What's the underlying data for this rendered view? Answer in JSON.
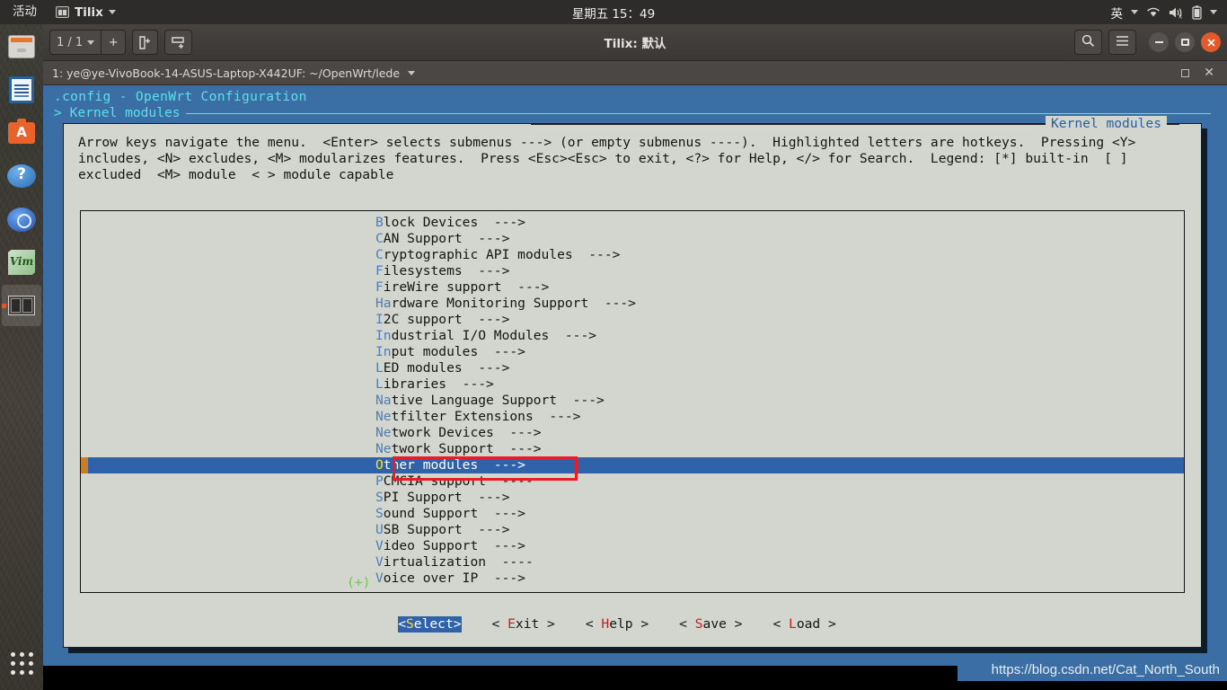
{
  "topbar": {
    "activities": "活动",
    "app_name": "Tilix",
    "app_icon": "terminal-icon",
    "clock_weekday": "星期五",
    "clock_time": "15：49",
    "ime": "英",
    "icons": [
      "wifi-icon",
      "volume-muted-icon",
      "battery-icon",
      "chevron-down-icon"
    ]
  },
  "dock": {
    "items": [
      {
        "name": "files",
        "icon": "files-icon"
      },
      {
        "name": "libreoffice-writer",
        "icon": "document-icon"
      },
      {
        "name": "ubuntu-software",
        "icon": "briefcase-icon"
      },
      {
        "name": "help",
        "icon": "question-mark-icon"
      },
      {
        "name": "chromium",
        "icon": "chromium-icon"
      },
      {
        "name": "vim",
        "icon": "vim-icon"
      },
      {
        "name": "tilix",
        "icon": "tilix-icon",
        "active": true
      }
    ],
    "show_apps": "show-applications-grid"
  },
  "window": {
    "title": "Tilix: 默认",
    "session_counter": "1 / 1",
    "buttons": {
      "new_session": "+",
      "new_terminal_right": "split-right-icon",
      "new_terminal_down": "split-down-icon",
      "search": "search-icon",
      "menu": "hamburger-menu-icon",
      "minimize": "minimize-icon",
      "maximize": "maximize-icon",
      "close": "close-icon"
    },
    "tab_title": "1: ye@ye-VivoBook-14-ASUS-Laptop-X442UF: ~/OpenWrt/lede"
  },
  "menuconfig": {
    "config_title": ".config - OpenWrt Configuration",
    "breadcrumb": "> Kernel modules",
    "dialog_title": "Kernel modules",
    "help_text": "Arrow keys navigate the menu.  <Enter> selects submenus ---> (or empty submenus ----).  Highlighted letters are hotkeys.  Pressing <Y>\nincludes, <N> excludes, <M> modularizes features.  Press <Esc><Esc> to exit, <?> for Help, </> for Search.  Legend: [*] built-in  [ ]\nexcluded  <M> module  < > module capable",
    "scroll_indicator": "(+)",
    "items": [
      {
        "hotkey": "B",
        "rest": "lock Devices",
        "arrow": "--->",
        "selected": false
      },
      {
        "hotkey": "C",
        "rest": "AN Support",
        "arrow": "--->",
        "selected": false
      },
      {
        "hotkey": "C",
        "rest": "ryptographic API modules",
        "arrow": "--->",
        "selected": false
      },
      {
        "hotkey": "F",
        "rest": "ilesystems",
        "arrow": "--->",
        "selected": false
      },
      {
        "hotkey": "F",
        "rest": "ireWire support",
        "arrow": "--->",
        "selected": false
      },
      {
        "hotkey": "Ha",
        "rest": "rdware Monitoring Support",
        "arrow": "--->",
        "selected": false
      },
      {
        "hotkey": "I",
        "rest": "2C support",
        "arrow": "--->",
        "selected": false
      },
      {
        "hotkey": "In",
        "rest": "dustrial I/O Modules",
        "arrow": "--->",
        "selected": false
      },
      {
        "hotkey": "In",
        "rest": "put modules",
        "arrow": "--->",
        "selected": false
      },
      {
        "hotkey": "L",
        "rest": "ED modules",
        "arrow": "--->",
        "selected": false
      },
      {
        "hotkey": "L",
        "rest": "ibraries",
        "arrow": "--->",
        "selected": false
      },
      {
        "hotkey": "Na",
        "rest": "tive Language Support",
        "arrow": "--->",
        "selected": false
      },
      {
        "hotkey": "Ne",
        "rest": "tfilter Extensions",
        "arrow": "--->",
        "selected": false
      },
      {
        "hotkey": "Ne",
        "rest": "twork Devices",
        "arrow": "--->",
        "selected": false
      },
      {
        "hotkey": "Ne",
        "rest": "twork Support",
        "arrow": "--->",
        "selected": false
      },
      {
        "hotkey": "O",
        "rest": "ther modules",
        "arrow": "--->",
        "selected": true
      },
      {
        "hotkey": "P",
        "rest": "CMCIA support",
        "arrow": "----",
        "selected": false
      },
      {
        "hotkey": "S",
        "rest": "PI Support",
        "arrow": "--->",
        "selected": false
      },
      {
        "hotkey": "S",
        "rest": "ound Support",
        "arrow": "--->",
        "selected": false
      },
      {
        "hotkey": "U",
        "rest": "SB Support",
        "arrow": "--->",
        "selected": false
      },
      {
        "hotkey": "V",
        "rest": "ideo Support",
        "arrow": "--->",
        "selected": false
      },
      {
        "hotkey": "V",
        "rest": "irtualization",
        "arrow": "----",
        "selected": false
      },
      {
        "hotkey": "V",
        "rest": "oice over IP",
        "arrow": "--->",
        "selected": false
      }
    ],
    "action_buttons": [
      {
        "prefix": "<",
        "hotkey": "S",
        "rest": "elect",
        "suffix": ">",
        "selected": true
      },
      {
        "prefix": "< ",
        "hotkey": "E",
        "rest": "xit",
        "suffix": " >",
        "selected": false
      },
      {
        "prefix": "< ",
        "hotkey": "H",
        "rest": "elp",
        "suffix": " >",
        "selected": false
      },
      {
        "prefix": "< ",
        "hotkey": "S",
        "rest": "ave",
        "suffix": " >",
        "selected": false
      },
      {
        "prefix": "< ",
        "hotkey": "L",
        "rest": "oad",
        "suffix": " >",
        "selected": false
      }
    ]
  },
  "watermark": "https://blog.csdn.net/Cat_North_South",
  "colors": {
    "curses_background": "#3a6ea5",
    "dialog_background": "#d2d6ce",
    "selection": "#2f62a8",
    "hotkey_blue": "#4f7db5",
    "hotkey_red": "#c12020",
    "hotkey_yellow": "#f5e33a",
    "title_cyan": "#5ce0e6",
    "annotation_red": "#ec1c24"
  }
}
